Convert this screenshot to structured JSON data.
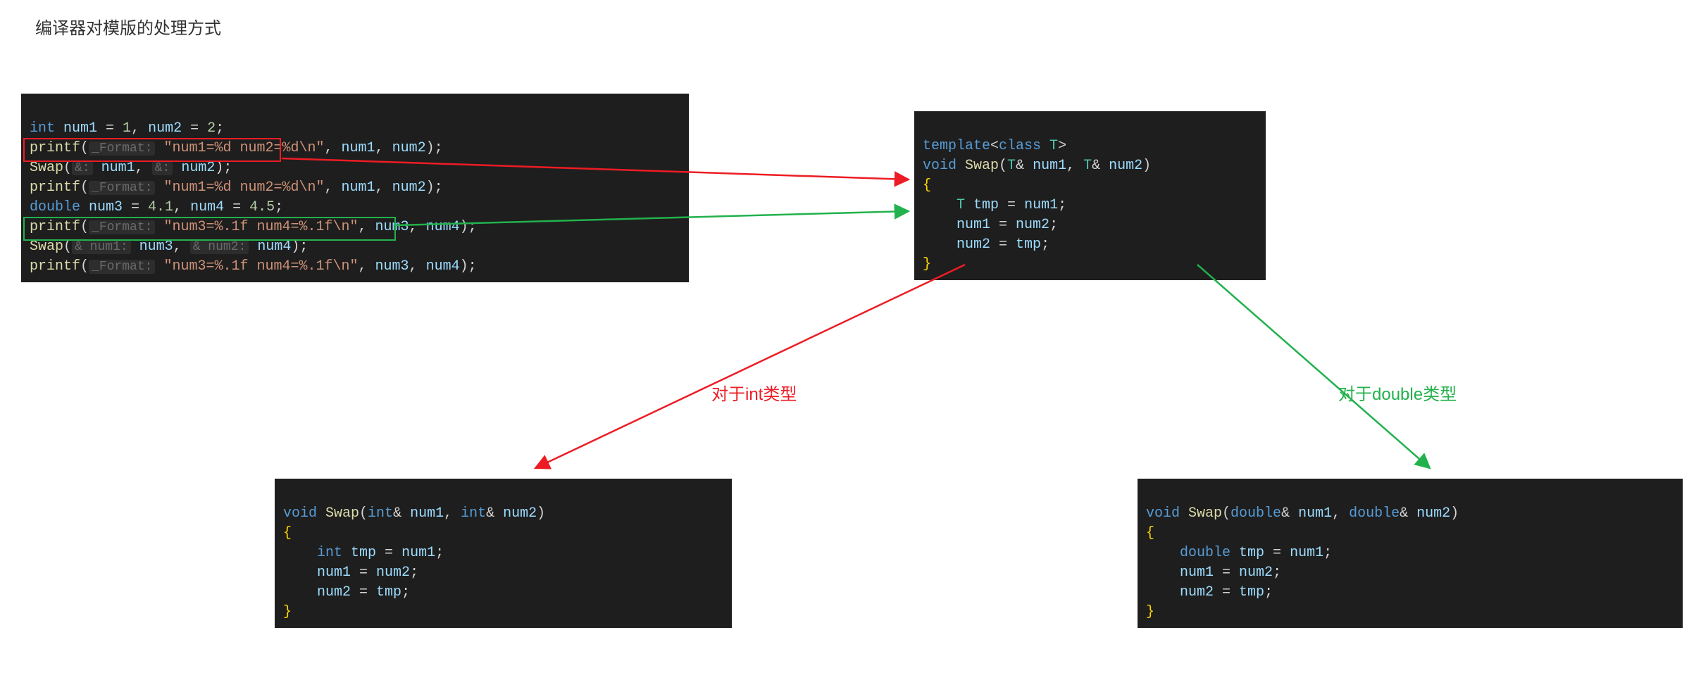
{
  "title": "编译器对模版的处理方式",
  "left_block": {
    "line1": {
      "pre": "int ",
      "v1": "num1",
      "eq": " = ",
      "n1": "1",
      "c": ", ",
      "v2": "num2",
      "eq2": " = ",
      "n2": "2",
      "end": ";"
    },
    "line2": {
      "fn": "printf",
      "open": "(",
      "hint": "_Format:",
      "sp": " ",
      "str": "\"num1=%d num2=%d\\n\"",
      "c": ", ",
      "a1": "num1",
      "c2": ", ",
      "a2": "num2",
      "close": ");"
    },
    "line3": {
      "fn": "Swap",
      "open": "(",
      "h1": "&:",
      "sp1": " ",
      "a1": "num1",
      "c": ", ",
      "h2": "&:",
      "sp2": " ",
      "a2": "num2",
      "close": ");"
    },
    "line4": {
      "fn": "printf",
      "open": "(",
      "hint": "_Format:",
      "sp": " ",
      "str": "\"num1=%d num2=%d\\n\"",
      "c": ", ",
      "a1": "num1",
      "c2": ", ",
      "a2": "num2",
      "close": ");"
    },
    "line5": {
      "pre": "double ",
      "v1": "num3",
      "eq": " = ",
      "n1": "4.1",
      "c": ", ",
      "v2": "num4",
      "eq2": " = ",
      "n2": "4.5",
      "end": ";"
    },
    "line6": {
      "fn": "printf",
      "open": "(",
      "hint": "_Format:",
      "sp": " ",
      "str": "\"num3=%.1f num4=%.1f\\n\"",
      "c": ", ",
      "a1": "num3",
      "c2": ", ",
      "a2": "num4",
      "close": ");"
    },
    "line7": {
      "fn": "Swap",
      "open": "(",
      "h1": "& num1:",
      "sp1": " ",
      "a1": "num3",
      "c": ", ",
      "h2": "& num2:",
      "sp2": " ",
      "a2": "num4",
      "close": ");"
    },
    "line8": {
      "fn": "printf",
      "open": "(",
      "hint": "_Format:",
      "sp": " ",
      "str": "\"num3=%.1f num4=%.1f\\n\"",
      "c": ", ",
      "a1": "num3",
      "c2": ", ",
      "a2": "num4",
      "close": ");"
    }
  },
  "template_block": {
    "l1": {
      "tmpl": "template",
      "lt": "<",
      "cls": "class ",
      "T": "T",
      "gt": ">"
    },
    "l2": {
      "kw": "void ",
      "fn": "Swap",
      "open": "(",
      "T1": "T",
      "amp1": "& ",
      "a1": "num1",
      "c": ", ",
      "T2": "T",
      "amp2": "& ",
      "a2": "num2",
      "close": ")"
    },
    "l3": "{",
    "l4": {
      "ind": "    ",
      "T": "T ",
      "tmp": "tmp",
      "eq": " = ",
      "src": "num1",
      "end": ";"
    },
    "l5": {
      "ind": "    ",
      "a": "num1",
      "eq": " = ",
      "b": "num2",
      "end": ";"
    },
    "l6": {
      "ind": "    ",
      "a": "num2",
      "eq": " = ",
      "b": "tmp",
      "end": ";"
    },
    "l7": "}"
  },
  "int_block": {
    "l1": {
      "kw": "void ",
      "fn": "Swap",
      "open": "(",
      "t1": "int",
      "amp1": "& ",
      "a1": "num1",
      "c": ", ",
      "t2": "int",
      "amp2": "& ",
      "a2": "num2",
      "close": ")"
    },
    "l2": "{",
    "l3": {
      "ind": "    ",
      "t": "int ",
      "tmp": "tmp",
      "eq": " = ",
      "src": "num1",
      "end": ";"
    },
    "l4": {
      "ind": "    ",
      "a": "num1",
      "eq": " = ",
      "b": "num2",
      "end": ";"
    },
    "l5": {
      "ind": "    ",
      "a": "num2",
      "eq": " = ",
      "b": "tmp",
      "end": ";"
    },
    "l6": "}"
  },
  "double_block": {
    "l1": {
      "kw": "void ",
      "fn": "Swap",
      "open": "(",
      "t1": "double",
      "amp1": "& ",
      "a1": "num1",
      "c": ", ",
      "t2": "double",
      "amp2": "& ",
      "a2": "num2",
      "close": ")"
    },
    "l2": "{",
    "l3": {
      "ind": "    ",
      "t": "double ",
      "tmp": "tmp",
      "eq": " = ",
      "src": "num1",
      "end": ";"
    },
    "l4": {
      "ind": "    ",
      "a": "num1",
      "eq": " = ",
      "b": "num2",
      "end": ";"
    },
    "l5": {
      "ind": "    ",
      "a": "num2",
      "eq": " = ",
      "b": "tmp",
      "end": ";"
    },
    "l6": "}"
  },
  "annotations": {
    "int_label": "对于int类型",
    "double_label": "对于double类型"
  },
  "colors": {
    "red": "#ed1c24",
    "green": "#22b14c"
  }
}
